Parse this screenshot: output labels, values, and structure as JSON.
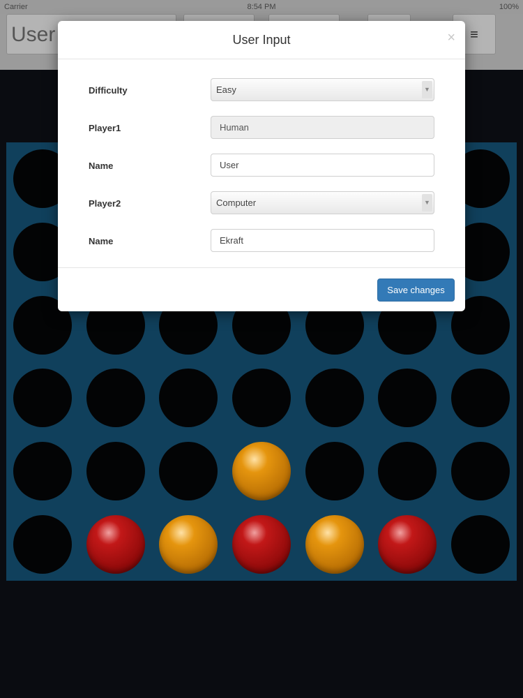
{
  "status_bar": {
    "carrier": "Carrier",
    "time": "8:54 PM",
    "battery": "100%"
  },
  "header": {
    "player_name": "User",
    "menu_icon_glyph": "≡"
  },
  "board": {
    "rows": [
      [
        "empty",
        "empty",
        "empty",
        "empty",
        "empty",
        "empty",
        "empty"
      ],
      [
        "empty",
        "empty",
        "empty",
        "empty",
        "empty",
        "empty",
        "empty"
      ],
      [
        "empty",
        "empty",
        "empty",
        "empty",
        "empty",
        "empty",
        "empty"
      ],
      [
        "empty",
        "empty",
        "empty",
        "empty",
        "empty",
        "empty",
        "empty"
      ],
      [
        "empty",
        "empty",
        "empty",
        "yellow",
        "empty",
        "empty",
        "empty"
      ],
      [
        "empty",
        "red",
        "yellow",
        "red",
        "yellow",
        "red",
        "empty"
      ]
    ],
    "colors": {
      "board": "#10405c",
      "red": "#c21818",
      "yellow": "#e5950e"
    }
  },
  "modal": {
    "title": "User Input",
    "close_glyph": "×",
    "fields": {
      "difficulty": {
        "label": "Difficulty",
        "value": "Easy"
      },
      "player1": {
        "label": "Player1",
        "value": "Human"
      },
      "name1": {
        "label": "Name",
        "value": "User"
      },
      "player2": {
        "label": "Player2",
        "value": "Computer"
      },
      "name2": {
        "label": "Name",
        "value": "Ekraft"
      }
    },
    "save_label": "Save changes",
    "accent_color": "#337ab7"
  }
}
